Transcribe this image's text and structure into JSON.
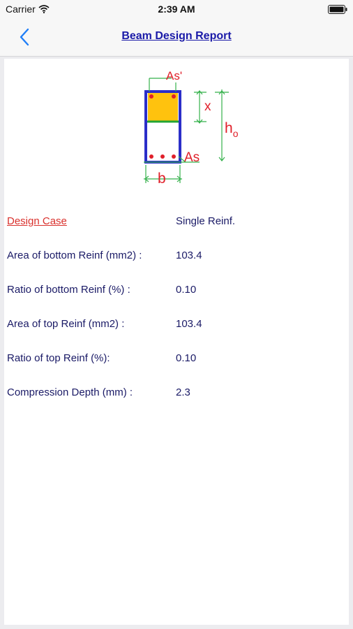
{
  "status_bar": {
    "carrier": "Carrier",
    "time": "2:39 AM"
  },
  "nav": {
    "title": "Beam Design Report"
  },
  "diagram": {
    "top_steel_label": "As'",
    "bottom_steel_label": "As",
    "compression_depth_label": "x",
    "effective_depth_label": "h",
    "effective_depth_sub": "o",
    "width_label": "b"
  },
  "report": {
    "design_case": {
      "label": "Design Case",
      "value": "Single Reinf."
    },
    "rows": [
      {
        "label": "Area of bottom Reinf (mm2) :",
        "value": "103.4"
      },
      {
        "label": "Ratio of bottom Reinf (%) :",
        "value": "0.10"
      },
      {
        "label": "Area of top Reinf (mm2) :",
        "value": "103.4"
      },
      {
        "label": "Ratio of top Reinf (%):",
        "value": "0.10"
      },
      {
        "label": "Compression Depth (mm) :",
        "value": "2.3"
      }
    ]
  },
  "colors": {
    "title": "#1a1aa8",
    "label": "#1a1a66",
    "link": "#d9302c",
    "beam_outline": "#2b2ec9",
    "compression_zone": "#ffc20e",
    "neutral_axis": "#22a533",
    "rebar": "#e0202a",
    "dimension": "#33b04a"
  }
}
